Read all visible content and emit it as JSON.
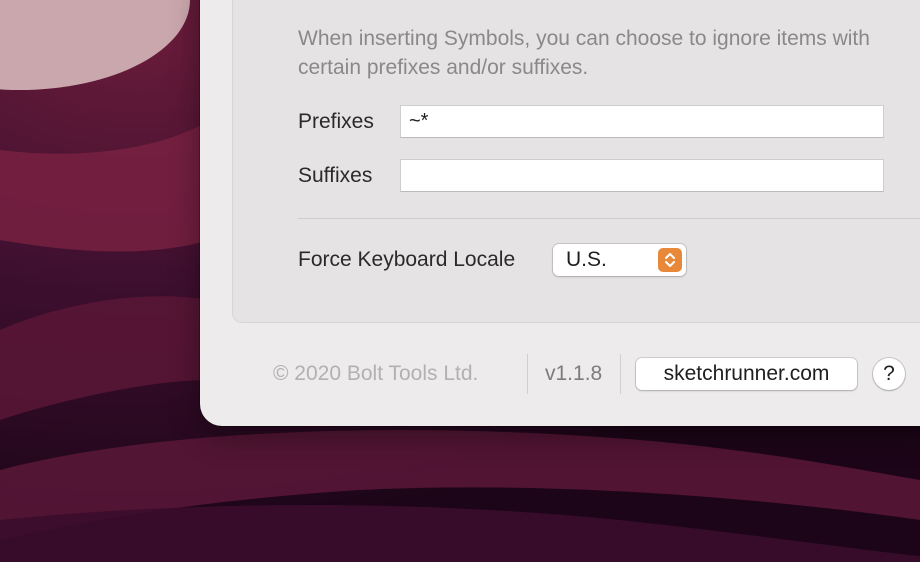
{
  "symbols": {
    "description": "When inserting Symbols, you can choose to ignore items with certain prefixes and/or suffixes.",
    "prefixes_label": "Prefixes",
    "prefixes_value": "~*",
    "suffixes_label": "Suffixes",
    "suffixes_value": ""
  },
  "keyboard": {
    "label": "Force Keyboard Locale",
    "selected": "U.S."
  },
  "footer": {
    "copyright": "© 2020 Bolt Tools Ltd.",
    "version": "v1.1.8",
    "website_button": "sketchrunner.com",
    "help_button": "?"
  },
  "colors": {
    "accent": "#e8893a",
    "window_bg": "#eeebed",
    "panel_bg": "#e6e3e5",
    "wallpaper": "#2a0a22"
  },
  "icons": {
    "popup_stepper": "up-down-chevron-icon"
  }
}
